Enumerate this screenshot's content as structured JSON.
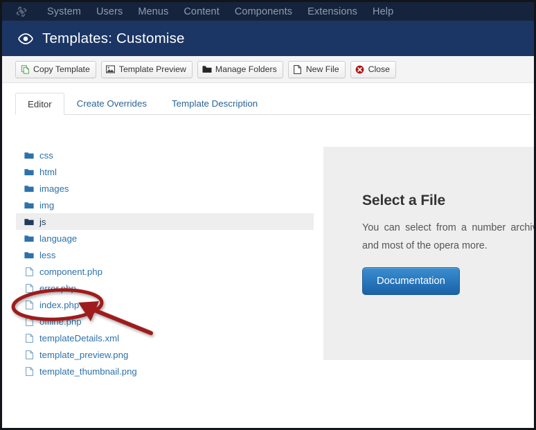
{
  "topbar": {
    "logo_icon": "joomla-logo-icon",
    "menu": [
      {
        "label": "System"
      },
      {
        "label": "Users"
      },
      {
        "label": "Menus"
      },
      {
        "label": "Content"
      },
      {
        "label": "Components"
      },
      {
        "label": "Extensions"
      },
      {
        "label": "Help"
      }
    ]
  },
  "header": {
    "icon": "eye-icon",
    "title": "Templates: Customise"
  },
  "toolbar": {
    "buttons": [
      {
        "label": "Copy Template",
        "icon": "copy-icon"
      },
      {
        "label": "Template Preview",
        "icon": "image-icon"
      },
      {
        "label": "Manage Folders",
        "icon": "folder-open-icon"
      },
      {
        "label": "New File",
        "icon": "file-icon"
      },
      {
        "label": "Close",
        "icon": "close-circle-icon"
      }
    ]
  },
  "tabs": [
    {
      "label": "Editor",
      "active": true
    },
    {
      "label": "Create Overrides",
      "active": false
    },
    {
      "label": "Template Description",
      "active": false
    }
  ],
  "files": [
    {
      "name": "css",
      "type": "folder",
      "selected": false
    },
    {
      "name": "html",
      "type": "folder",
      "selected": false
    },
    {
      "name": "images",
      "type": "folder",
      "selected": false
    },
    {
      "name": "img",
      "type": "folder",
      "selected": false
    },
    {
      "name": "js",
      "type": "folder",
      "selected": true
    },
    {
      "name": "language",
      "type": "folder",
      "selected": false
    },
    {
      "name": "less",
      "type": "folder",
      "selected": false
    },
    {
      "name": "component.php",
      "type": "file",
      "selected": false
    },
    {
      "name": "error.php",
      "type": "file",
      "selected": false
    },
    {
      "name": "index.php",
      "type": "file",
      "selected": false
    },
    {
      "name": "offline.php",
      "type": "file",
      "selected": false
    },
    {
      "name": "templateDetails.xml",
      "type": "file",
      "selected": false
    },
    {
      "name": "template_preview.png",
      "type": "file",
      "selected": false
    },
    {
      "name": "template_thumbnail.png",
      "type": "file",
      "selected": false
    }
  ],
  "info_panel": {
    "title": "Select a File",
    "body": "You can select from a number archives and most of the opera more.",
    "button_label": "Documentation"
  },
  "annotation": {
    "shape": "red-ellipse-and-arrow",
    "color": "#9e1b1b",
    "target": "index.php"
  },
  "colors": {
    "topbar_bg": "#15243c",
    "header_bg": "#1b3664",
    "toolbar_bg": "#f4f4f4",
    "link_blue": "#2d72ab",
    "panel_bg": "#eeeeee",
    "annotation_red": "#9e1b1b"
  }
}
